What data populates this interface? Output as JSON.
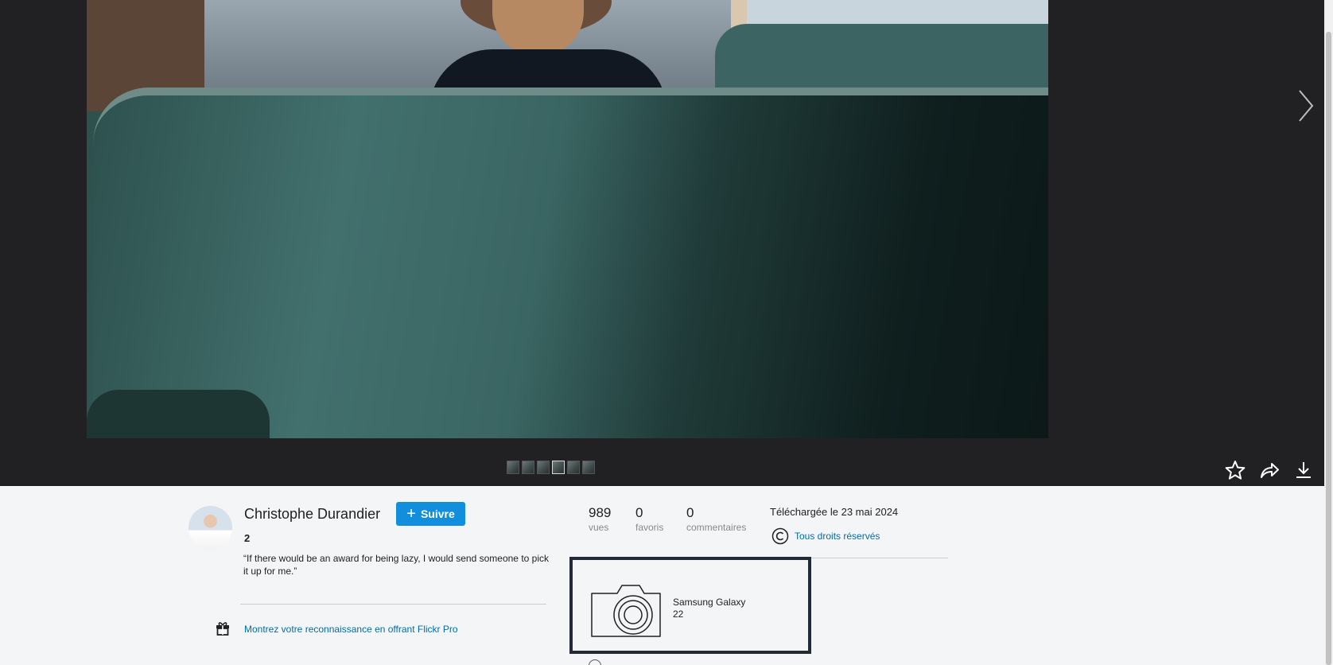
{
  "viewer": {
    "filmstrip_count": 6,
    "filmstrip_active_index": 3,
    "actions": [
      {
        "name": "favorite-star-icon"
      },
      {
        "name": "share-arrow-icon"
      },
      {
        "name": "download-icon"
      }
    ],
    "next_icon": "chevron-right-icon"
  },
  "author": {
    "name": "Christophe Durandier",
    "follow_label": "Suivre",
    "photo_count": "2",
    "quote": "“If there would be an award for being lazy, I would send someone to pick it up for me.”",
    "pro_link": "Montrez votre reconnaissance en offrant Flickr Pro"
  },
  "stats": {
    "views": {
      "value": "989",
      "label": "vues"
    },
    "faves": {
      "value": "0",
      "label": "favoris"
    },
    "comments": {
      "value": "0",
      "label": "commentaires"
    }
  },
  "meta": {
    "uploaded": "Téléchargée le 23 mai 2024",
    "license": "Tous droits réservés"
  },
  "camera": {
    "name_line1": "Samsung Galaxy",
    "name_line2": "22"
  },
  "colors": {
    "viewer_bg": "#212124",
    "page_bg": "#f3f5f6",
    "accent_blue": "#128fdc",
    "link_blue": "#006dac"
  }
}
